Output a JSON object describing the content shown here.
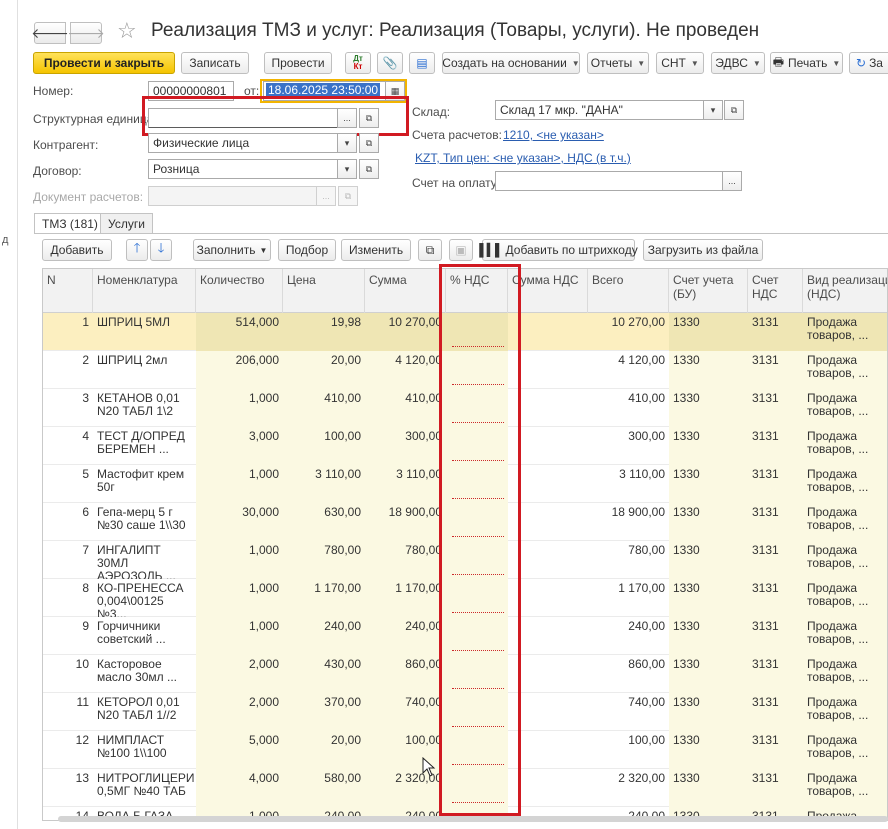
{
  "side": {
    "label": "д"
  },
  "title": {
    "text": "Реализация ТМЗ и услуг: Реализация (Товары, услуги). Не проведен"
  },
  "toolbar": {
    "post_close": "Провести и закрыть",
    "save": "Записать",
    "post": "Провести",
    "dt": "Дт",
    "kt": "Кт",
    "create_based": "Создать на основании",
    "reports": "Отчеты",
    "snt": "СНТ",
    "edvs": "ЭДВС",
    "print": "Печать",
    "more": "За"
  },
  "form": {
    "number_label": "Номер:",
    "number_value": "00000000801",
    "from_label": "от:",
    "date_value": "18.06.2025 23:50:00",
    "struct_unit_label": "Структурная единица",
    "struct_unit_value": "",
    "warehouse_label": "Склад:",
    "warehouse_value": "Склад 17 мкр. \"ДАНА\"",
    "contractor_label": "Контрагент:",
    "contractor_value": "Физические лица",
    "accounts_label": "Счета расчетов:",
    "accounts_link": "1210, <не указан>",
    "price_link": "KZT, Тип цен: <не указан>, НДС (в т.ч.)",
    "contract_label": "Договор:",
    "contract_value": "Розница",
    "invoice_label": "Счет на оплату:",
    "invoice_value": "",
    "settle_doc_label": "Документ расчетов:",
    "settle_doc_value": "",
    "ellipsis": "...",
    "open": "⧉",
    "dropdown": "▾"
  },
  "tabs": [
    {
      "label": "ТМЗ (181)"
    },
    {
      "label": "Услуги"
    }
  ],
  "table_toolbar": {
    "add": "Добавить",
    "fill": "Заполнить",
    "pick": "Подбор",
    "change": "Изменить",
    "add_barcode": "Добавить по штрихкоду",
    "load_file": "Загрузить из файла"
  },
  "columns": {
    "n": "N",
    "item": "Номенклатура",
    "qty": "Количество",
    "price": "Цена",
    "sum": "Сумма",
    "vat_pct": "% НДС",
    "vat_sum": "Сумма НДС",
    "total": "Всего",
    "acc1": "Счет учета",
    "acc1b": "(БУ)",
    "acc2": "Счет",
    "acc2b": "НДС",
    "kind": "Вид реализации",
    "kindb": "(НДС)"
  },
  "rows": [
    {
      "n": "1",
      "item1": "ШПРИЦ 5МЛ",
      "item2": "",
      "qty": "514,000",
      "price": "19,98",
      "sum": "10 270,00",
      "total": "10 270,00",
      "acc1": "1330",
      "acc2": "3131",
      "kind1": "Продажа",
      "kind2": "товаров, ..."
    },
    {
      "n": "2",
      "item1": "ШПРИЦ 2мл",
      "item2": "",
      "qty": "206,000",
      "price": "20,00",
      "sum": "4 120,00",
      "total": "4 120,00",
      "acc1": "1330",
      "acc2": "3131",
      "kind1": "Продажа",
      "kind2": "товаров, ..."
    },
    {
      "n": "3",
      "item1": "КЕТАНОВ 0,01",
      "item2": "N20 ТАБЛ 1\\2",
      "qty": "1,000",
      "price": "410,00",
      "sum": "410,00",
      "total": "410,00",
      "acc1": "1330",
      "acc2": "3131",
      "kind1": "Продажа",
      "kind2": "товаров, ..."
    },
    {
      "n": "4",
      "item1": "ТЕСТ Д/ОПРЕД",
      "item2": "БЕРЕМЕН ...",
      "qty": "3,000",
      "price": "100,00",
      "sum": "300,00",
      "total": "300,00",
      "acc1": "1330",
      "acc2": "3131",
      "kind1": "Продажа",
      "kind2": "товаров, ..."
    },
    {
      "n": "5",
      "item1": "Мастофит крем",
      "item2": "50г",
      "qty": "1,000",
      "price": "3 110,00",
      "sum": "3 110,00",
      "total": "3 110,00",
      "acc1": "1330",
      "acc2": "3131",
      "kind1": "Продажа",
      "kind2": "товаров, ..."
    },
    {
      "n": "6",
      "item1": "Гепа-мерц 5 г",
      "item2": "№30 саше 1\\\\30",
      "qty": "30,000",
      "price": "630,00",
      "sum": "18 900,00",
      "total": "18 900,00",
      "acc1": "1330",
      "acc2": "3131",
      "kind1": "Продажа",
      "kind2": "товаров, ..."
    },
    {
      "n": "7",
      "item1": "ИНГАЛИПТ 30МЛ",
      "item2": "АЭРОЗОЛЬ ...",
      "qty": "1,000",
      "price": "780,00",
      "sum": "780,00",
      "total": "780,00",
      "acc1": "1330",
      "acc2": "3131",
      "kind1": "Продажа",
      "kind2": "товаров, ..."
    },
    {
      "n": "8",
      "item1": "КО-ПРЕНЕССА",
      "item2": "0,004\\00125 №3...",
      "qty": "1,000",
      "price": "1 170,00",
      "sum": "1 170,00",
      "total": "1 170,00",
      "acc1": "1330",
      "acc2": "3131",
      "kind1": "Продажа",
      "kind2": "товаров, ..."
    },
    {
      "n": "9",
      "item1": "Горчичники",
      "item2": "советский ...",
      "qty": "1,000",
      "price": "240,00",
      "sum": "240,00",
      "total": "240,00",
      "acc1": "1330",
      "acc2": "3131",
      "kind1": "Продажа",
      "kind2": "товаров, ..."
    },
    {
      "n": "10",
      "item1": "Касторовое",
      "item2": "масло 30мл ...",
      "qty": "2,000",
      "price": "430,00",
      "sum": "860,00",
      "total": "860,00",
      "acc1": "1330",
      "acc2": "3131",
      "kind1": "Продажа",
      "kind2": "товаров, ..."
    },
    {
      "n": "11",
      "item1": "КЕТОРОЛ 0,01",
      "item2": "N20 ТАБЛ 1//2",
      "qty": "2,000",
      "price": "370,00",
      "sum": "740,00",
      "total": "740,00",
      "acc1": "1330",
      "acc2": "3131",
      "kind1": "Продажа",
      "kind2": "товаров, ..."
    },
    {
      "n": "12",
      "item1": "НИМПЛАСТ",
      "item2": "№100 1\\\\100",
      "qty": "5,000",
      "price": "20,00",
      "sum": "100,00",
      "total": "100,00",
      "acc1": "1330",
      "acc2": "3131",
      "kind1": "Продажа",
      "kind2": "товаров, ..."
    },
    {
      "n": "13",
      "item1": "НИТРОГЛИЦЕРИ",
      "item2": "0,5МГ №40 ТАБ",
      "qty": "4,000",
      "price": "580,00",
      "sum": "2 320,00",
      "total": "2 320,00",
      "acc1": "1330",
      "acc2": "3131",
      "kind1": "Продажа",
      "kind2": "товаров, ..."
    },
    {
      "n": "14",
      "item1": "ВОДА Б.ГАЗА",
      "item2": "",
      "qty": "1,000",
      "price": "240,00",
      "sum": "240,00",
      "total": "240,00",
      "acc1": "1330",
      "acc2": "3131",
      "kind1": "Продажа",
      "kind2": "товаров, ..."
    }
  ]
}
